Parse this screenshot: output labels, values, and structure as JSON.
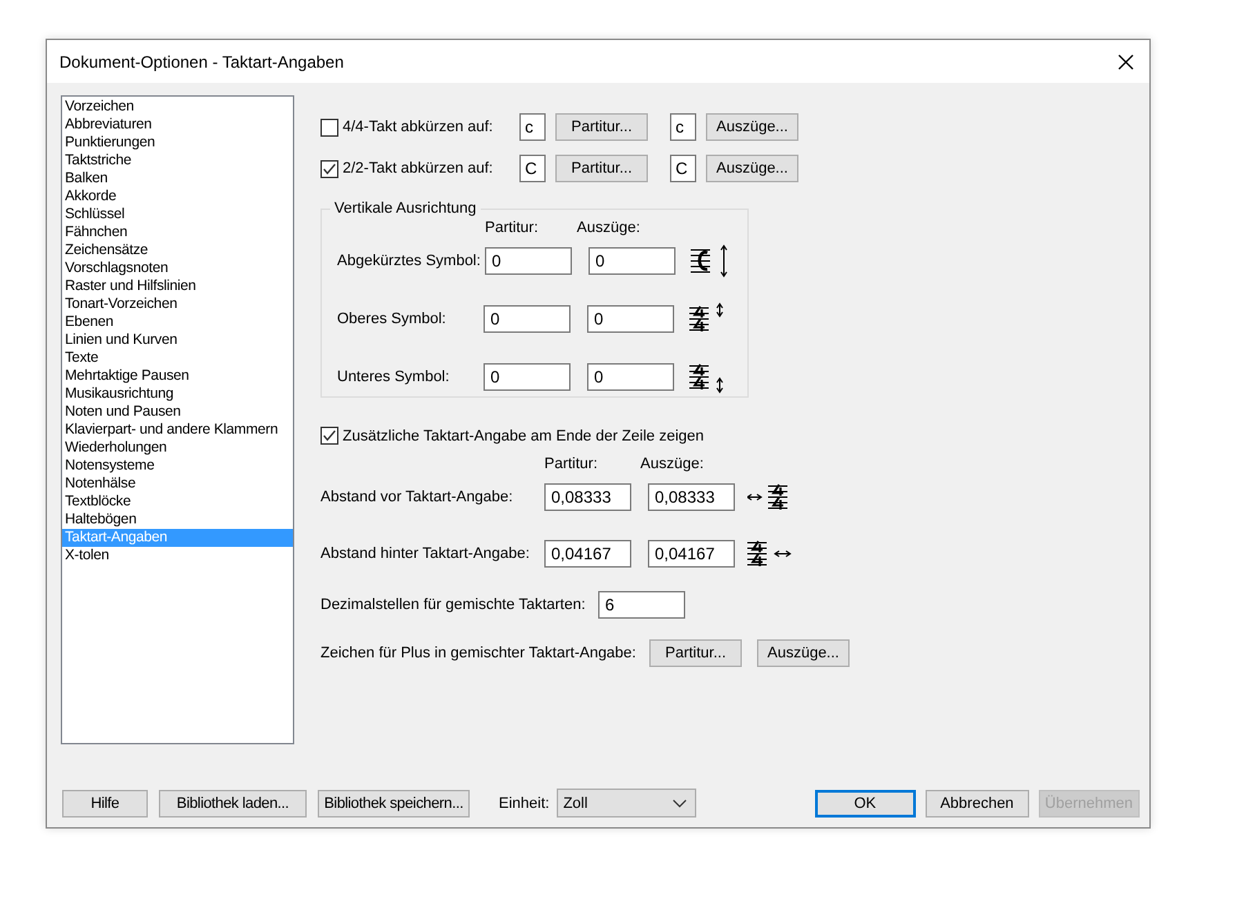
{
  "window": {
    "title": "Dokument-Optionen - Taktart-Angaben"
  },
  "categories": [
    {
      "label": "Vorzeichen",
      "selected": false
    },
    {
      "label": "Abbreviaturen",
      "selected": false
    },
    {
      "label": "Punktierungen",
      "selected": false
    },
    {
      "label": "Taktstriche",
      "selected": false
    },
    {
      "label": "Balken",
      "selected": false
    },
    {
      "label": "Akkorde",
      "selected": false
    },
    {
      "label": "Schlüssel",
      "selected": false
    },
    {
      "label": "Fähnchen",
      "selected": false
    },
    {
      "label": "Zeichensätze",
      "selected": false
    },
    {
      "label": "Vorschlagsnoten",
      "selected": false
    },
    {
      "label": "Raster und Hilfslinien",
      "selected": false
    },
    {
      "label": "Tonart-Vorzeichen",
      "selected": false
    },
    {
      "label": "Ebenen",
      "selected": false
    },
    {
      "label": "Linien und Kurven",
      "selected": false
    },
    {
      "label": "Texte",
      "selected": false
    },
    {
      "label": "Mehrtaktige Pausen",
      "selected": false
    },
    {
      "label": "Musikausrichtung",
      "selected": false
    },
    {
      "label": "Noten und Pausen",
      "selected": false
    },
    {
      "label": "Klavierpart- und andere Klammern",
      "selected": false
    },
    {
      "label": "Wiederholungen",
      "selected": false
    },
    {
      "label": "Notensysteme",
      "selected": false
    },
    {
      "label": "Notenhälse",
      "selected": false
    },
    {
      "label": "Textblöcke",
      "selected": false
    },
    {
      "label": "Haltebögen",
      "selected": false
    },
    {
      "label": "Taktart-Angaben",
      "selected": true
    },
    {
      "label": "X-tolen",
      "selected": false
    }
  ],
  "abbreviations": [
    {
      "label": "4/4-Takt abkürzen auf:",
      "checked": false,
      "score_symbol": "c",
      "score_button": "Partitur...",
      "parts_symbol": "c",
      "parts_button": "Auszüge..."
    },
    {
      "label": "2/2-Takt abkürzen auf:",
      "checked": true,
      "score_symbol": "C",
      "score_button": "Partitur...",
      "parts_symbol": "C",
      "parts_button": "Auszüge..."
    }
  ],
  "vertical_alignment": {
    "title": "Vertikale Ausrichtung",
    "column_headers": [
      "Partitur:",
      "Auszüge:"
    ],
    "rows": [
      {
        "label": "Abgekürztes Symbol:",
        "score": "0",
        "parts": "0",
        "kind": "abbreviated"
      },
      {
        "label": "Oberes Symbol:",
        "score": "0",
        "parts": "0",
        "kind": "top"
      },
      {
        "label": "Unteres Symbol:",
        "score": "0",
        "parts": "0",
        "kind": "bottom"
      }
    ]
  },
  "end_of_line": {
    "label": "Zusätzliche Taktart-Angabe am Ende der Zeile zeigen",
    "checked": true
  },
  "spacing": {
    "column_headers": [
      "Partitur:",
      "Auszüge:"
    ],
    "rows": [
      {
        "label": "Abstand vor Taktart-Angabe:",
        "score": "0,08333",
        "parts": "0,08333",
        "kind": "before"
      },
      {
        "label": "Abstand hinter Taktart-Angabe:",
        "score": "0,04167",
        "parts": "0,04167",
        "kind": "after"
      }
    ]
  },
  "decimal_places": {
    "label": "Dezimalstellen für gemischte Taktarten:",
    "value": "6"
  },
  "plus_sign": {
    "label": "Zeichen für Plus in gemischter Taktart-Angabe:",
    "buttons": [
      "Partitur...",
      "Auszüge..."
    ]
  },
  "footer": {
    "left_buttons": [
      "Hilfe",
      "Bibliothek laden...",
      "Bibliothek speichern..."
    ],
    "unit_label": "Einheit:",
    "unit_value": "Zoll",
    "actions": [
      {
        "label": "OK",
        "default": true,
        "disabled": false
      },
      {
        "label": "Abbrechen",
        "default": false,
        "disabled": false
      },
      {
        "label": "Übernehmen",
        "default": false,
        "disabled": true
      }
    ]
  }
}
